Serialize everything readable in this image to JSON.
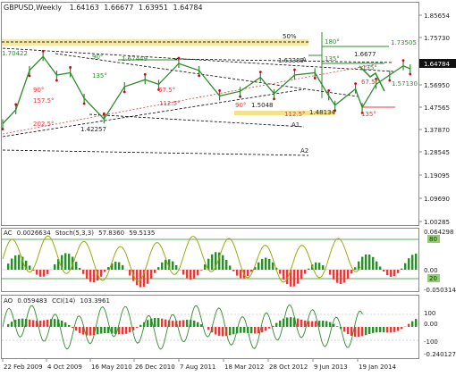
{
  "chart_data": {
    "type": "line",
    "title": "GBPUSD,Weekly",
    "ohlc": [
      "1.64163",
      "1.66677",
      "1.63951",
      "1.64784"
    ],
    "colors": {
      "bar": "#2e8b2e",
      "marker": "#d0021b",
      "trend": "#000000",
      "fib": "#e03c3c",
      "level_box": "#2e8b2e",
      "hist_pos": "#2e8b2e",
      "hist_neg": "#e03c3c",
      "oscillator": "#9aaa10",
      "cci": "#2e8b2e",
      "price_label_bg": "#111111",
      "band_50": "#f3e28c"
    },
    "y_range": [
      0.988,
      1.89
    ],
    "price_axis_ticks": [
      "1.85654",
      "1.75730",
      "1.66335",
      "1.56950",
      "1.47565",
      "1.37870",
      "1.28545",
      "1.19095",
      "1.09690",
      "1.00285"
    ],
    "current_price": "1.64784",
    "date_ticks": [
      "22 Feb 2009",
      "4 Oct 2009",
      "16 May 2010",
      "26 Dec 2010",
      "7 Aug 2011",
      "18 Mar 2012",
      "28 Oct 2012",
      "9 Jun 2013",
      "19 Jan 2014"
    ],
    "price_series": [
      {
        "d": "2009-02",
        "v": 1.41
      },
      {
        "d": "2009-04",
        "v": 1.47
      },
      {
        "d": "2009-06",
        "v": 1.64
      },
      {
        "d": "2009-08",
        "v": 1.7
      },
      {
        "d": "2009-10",
        "v": 1.62
      },
      {
        "d": "2009-12",
        "v": 1.63
      },
      {
        "d": "2010-02",
        "v": 1.52
      },
      {
        "d": "2010-05",
        "v": 1.43
      },
      {
        "d": "2010-08",
        "v": 1.57
      },
      {
        "d": "2010-11",
        "v": 1.6
      },
      {
        "d": "2011-01",
        "v": 1.58
      },
      {
        "d": "2011-04",
        "v": 1.67
      },
      {
        "d": "2011-07",
        "v": 1.64
      },
      {
        "d": "2011-10",
        "v": 1.53
      },
      {
        "d": "2012-01",
        "v": 1.55
      },
      {
        "d": "2012-04",
        "v": 1.61
      },
      {
        "d": "2012-06",
        "v": 1.54
      },
      {
        "d": "2012-09",
        "v": 1.62
      },
      {
        "d": "2012-12",
        "v": 1.63
      },
      {
        "d": "2013-02",
        "v": 1.53
      },
      {
        "d": "2013-03",
        "v": 1.49
      },
      {
        "d": "2013-06",
        "v": 1.56
      },
      {
        "d": "2013-07",
        "v": 1.48
      },
      {
        "d": "2013-09",
        "v": 1.58
      },
      {
        "d": "2013-11",
        "v": 1.62
      },
      {
        "d": "2014-01",
        "v": 1.66
      },
      {
        "d": "2014-02",
        "v": 1.647
      }
    ],
    "price_labels": [
      "1.70422",
      "1.67449",
      "1.63389",
      "1.6677",
      "1.42257",
      "1.5048",
      "1.48134",
      "1.57130",
      "1.73505"
    ],
    "level_labels": [
      "50%",
      "180°",
      "135°",
      "90°",
      "157.5°",
      "202.5°",
      "67.5°",
      "112.5°",
      "90°",
      "112.5°",
      "135°",
      "135°",
      "135°",
      "A",
      "A1",
      "A2",
      "67.5°",
      "90°"
    ],
    "indicators": [
      {
        "name": "AC",
        "value": "0.0026634",
        "levels": [
          "80",
          "20"
        ],
        "axis_ticks": [
          "0.064298",
          "0.00",
          "-0.050314"
        ]
      },
      {
        "name": "Stoch(5,3,3)",
        "values": [
          "57.8360",
          "59.5135"
        ]
      },
      {
        "name": "AO",
        "value": "0.059483",
        "axis_ticks": [
          "100",
          "0.00",
          "-100",
          "-0.240127"
        ]
      },
      {
        "name": "CCI(14)",
        "value": "103.3961"
      }
    ]
  }
}
